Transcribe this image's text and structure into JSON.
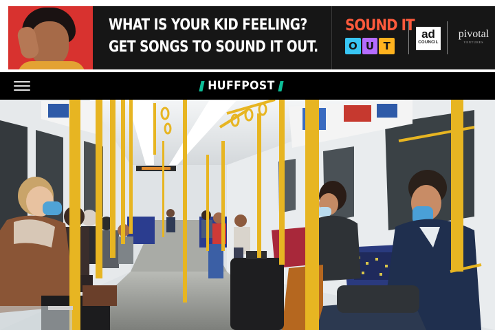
{
  "ad": {
    "headline_line1": "WHAT IS YOUR KID FEELING?",
    "headline_line2": "GET SONGS TO SOUND IT OUT.",
    "campaign_word_top": "SOUND IT",
    "campaign_word_bottom": [
      "O",
      "U",
      "T"
    ],
    "campaign_colors": [
      "#ff5a3c",
      "#38c6f4",
      "#b56cff",
      "#ffb21e",
      "#ff5a3c"
    ],
    "sponsor_1_big": "ad",
    "sponsor_1_small": "COUNCIL",
    "sponsor_2": "pivotal",
    "sponsor_2_sub": "VENTURES"
  },
  "header": {
    "menu_icon": "hamburger-menu-icon",
    "brand": "HUFFPOST",
    "brand_color": "#0dbe98"
  },
  "hero": {
    "description_icon": "subway-carriage-photo",
    "colors": {
      "handrail": "#e7b522",
      "wall": "#e9ecee",
      "floor": "#8d8f8b",
      "seat_moquette": "#2b3d8f"
    }
  }
}
